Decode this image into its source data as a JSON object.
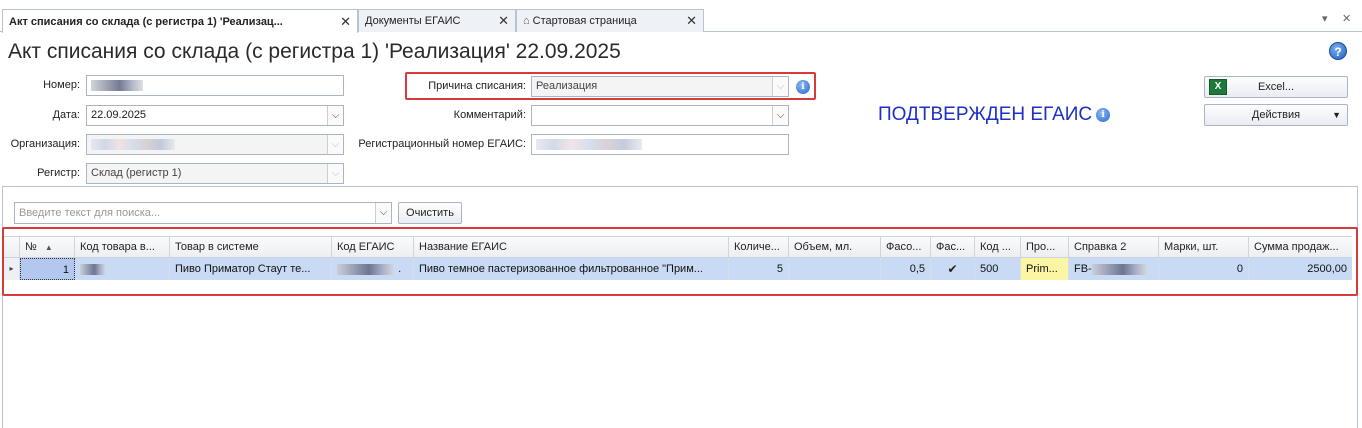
{
  "tabs": [
    {
      "label": "Акт списания со склада (с регистра 1) 'Реализац...",
      "close": "✕",
      "active": true
    },
    {
      "label": "Документы ЕГАИС",
      "close": "✕",
      "active": false
    },
    {
      "label": "Стартовая страница",
      "close": "✕",
      "active": false
    }
  ],
  "window_controls": {
    "menu": "▾",
    "close": "✕"
  },
  "title": "Акт списания со склада (с регистра 1) 'Реализация' 22.09.2025",
  "help": "?",
  "form": {
    "number_label": "Номер:",
    "date_label": "Дата:",
    "date_value": "22.09.2025",
    "org_label": "Организация:",
    "register_label": "Регистр:",
    "register_value": "Склад (регистр 1)",
    "reason_label": "Причина списания:",
    "reason_value": "Реализация",
    "comment_label": "Комментарий:",
    "comment_value": "",
    "egais_reg_label": "Регистрационный номер ЕГАИС:"
  },
  "status": {
    "text": "ПОДТВЕРЖДЕН ЕГАИС"
  },
  "buttons": {
    "excel": "Excel...",
    "actions": "Действия",
    "clear": "Очистить"
  },
  "search": {
    "placeholder": "Введите текст для поиска..."
  },
  "table": {
    "columns": [
      "№",
      "Код товара в...",
      "Товар в системе",
      "Код ЕГАИС",
      "Название ЕГАИС",
      "Количе...",
      "Объем, мл.",
      "Фасо...",
      "Фас...",
      "Код ...",
      "Про...",
      "Справка 2",
      "Марки, шт.",
      "Сумма продаж..."
    ],
    "rows": [
      {
        "num": "1",
        "product": "Пиво Приматор Стаут те...",
        "egais_code_suffix": ".",
        "egais_name": "Пиво темное пастеризованное фильтрованное \"Прим...",
        "qty": "5",
        "volume": "",
        "packing": "0,5",
        "packed": true,
        "code": "500",
        "producer": "Prim...",
        "cert2_prefix": "FB-",
        "marks": "0",
        "sum": "2500,00"
      }
    ]
  },
  "colors": {
    "accent_red": "#d8393a",
    "status_blue": "#1d2fc4",
    "row_selected": "#c9daf4",
    "cell_yellow": "#fbf6a4"
  }
}
